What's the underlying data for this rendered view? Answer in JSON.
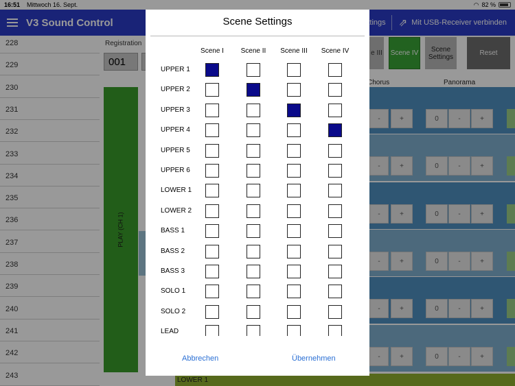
{
  "status_bar": {
    "time": "16:51",
    "date": "Mittwoch 16. Sept.",
    "battery": "82 %",
    "wifi_icon": "wifi-icon"
  },
  "nav": {
    "title": "V3 Sound Control",
    "settings_partial": "ttings",
    "usb": "Mit USB-Receiver verbinden"
  },
  "background": {
    "row_numbers": [
      "228",
      "229",
      "230",
      "231",
      "232",
      "233",
      "234",
      "235",
      "236",
      "237",
      "238",
      "239",
      "240",
      "241",
      "242",
      "243"
    ],
    "registration_label": "Registration",
    "registration_value": "001",
    "play_label": "PLAY (CH 1)",
    "scene3_partial": "e III",
    "scene4": "Scene IV",
    "scene_settings": "Scene Settings",
    "reset": "Reset",
    "chorus": "Chorus",
    "panorama": "Panorama",
    "lower_label": "LOWER 1",
    "panorama_value": "0",
    "minus": "-",
    "plus": "+"
  },
  "modal": {
    "title": "Scene Settings",
    "columns": [
      "Scene I",
      "Scene II",
      "Scene III",
      "Scene IV"
    ],
    "rows": [
      {
        "label": "UPPER 1",
        "checked": [
          true,
          false,
          false,
          false
        ]
      },
      {
        "label": "UPPER 2",
        "checked": [
          false,
          true,
          false,
          false
        ]
      },
      {
        "label": "UPPER 3",
        "checked": [
          false,
          false,
          true,
          false
        ]
      },
      {
        "label": "UPPER 4",
        "checked": [
          false,
          false,
          false,
          true
        ]
      },
      {
        "label": "UPPER 5",
        "checked": [
          false,
          false,
          false,
          false
        ]
      },
      {
        "label": "UPPER 6",
        "checked": [
          false,
          false,
          false,
          false
        ]
      },
      {
        "label": "LOWER 1",
        "checked": [
          false,
          false,
          false,
          false
        ]
      },
      {
        "label": "LOWER 2",
        "checked": [
          false,
          false,
          false,
          false
        ]
      },
      {
        "label": "BASS 1",
        "checked": [
          false,
          false,
          false,
          false
        ]
      },
      {
        "label": "BASS 2",
        "checked": [
          false,
          false,
          false,
          false
        ]
      },
      {
        "label": "BASS 3",
        "checked": [
          false,
          false,
          false,
          false
        ]
      },
      {
        "label": "SOLO 1",
        "checked": [
          false,
          false,
          false,
          false
        ]
      },
      {
        "label": "SOLO 2",
        "checked": [
          false,
          false,
          false,
          false
        ]
      },
      {
        "label": "LEAD",
        "checked": [
          false,
          false,
          false,
          false
        ]
      }
    ],
    "cancel": "Abbrechen",
    "apply": "Übernehmen"
  },
  "colors": {
    "nav_blue": "#2b3bc7",
    "checked": "#0a0a8a",
    "play_green": "#3a9b2a",
    "link": "#2a6fd4"
  }
}
